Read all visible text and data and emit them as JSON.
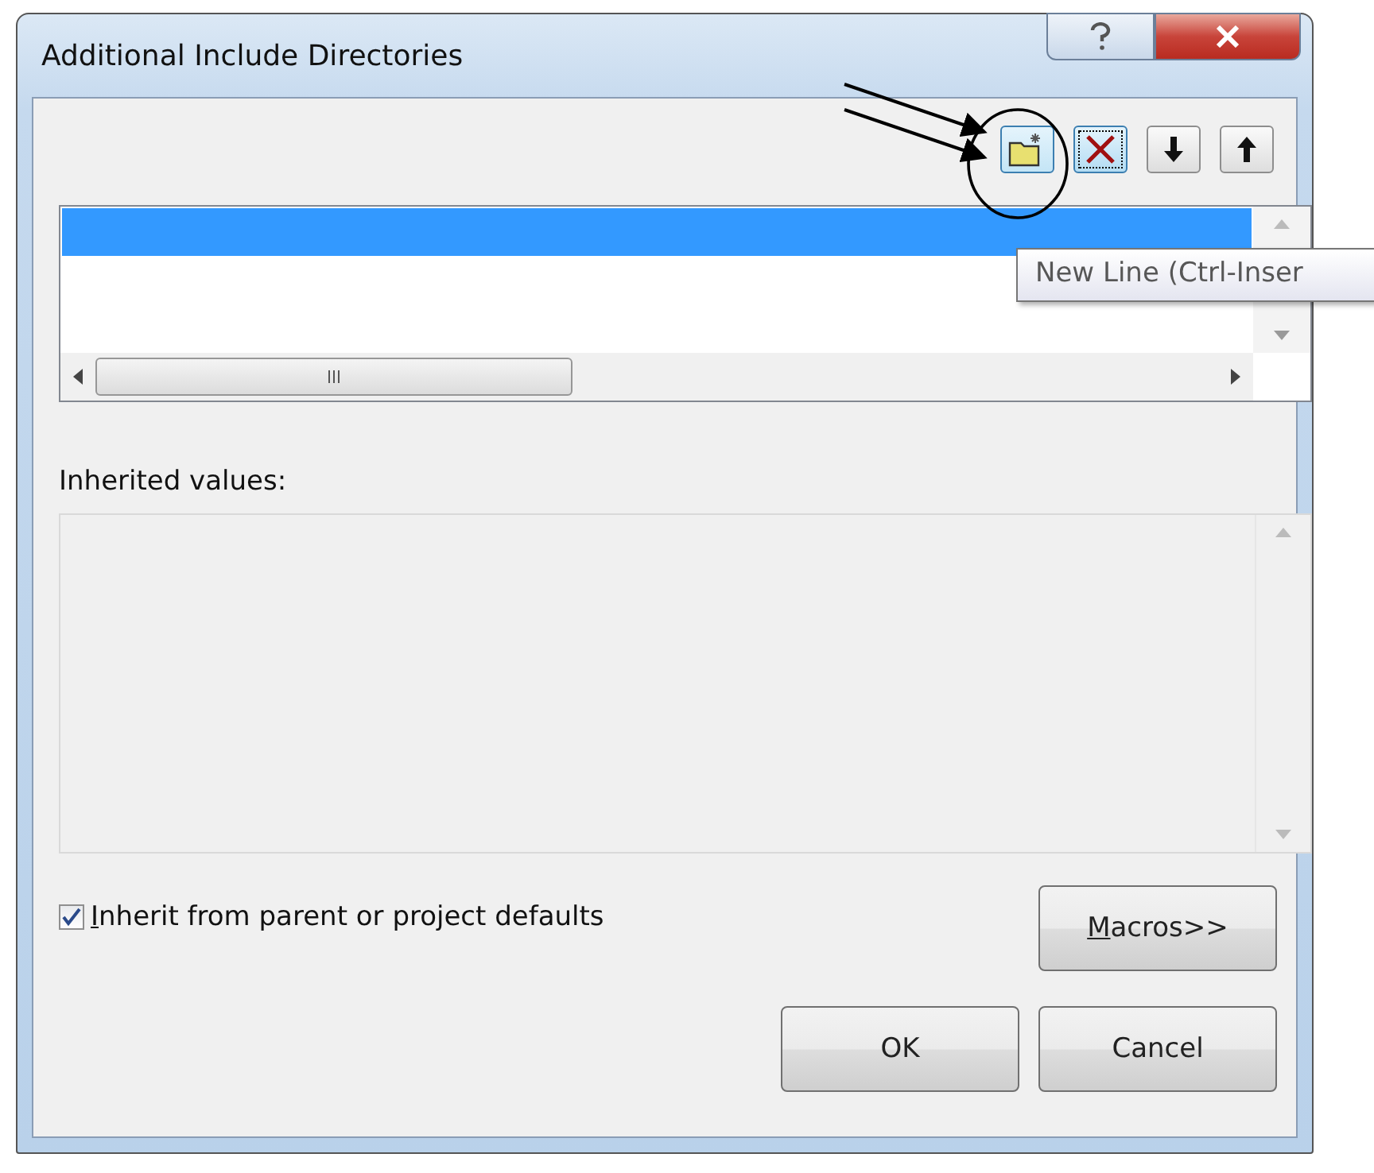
{
  "window": {
    "title": "Additional Include Directories"
  },
  "toolbar": [
    {
      "kind": "new-line",
      "focused": false
    },
    {
      "kind": "delete",
      "focused": true
    },
    {
      "kind": "move-down",
      "focused": false
    },
    {
      "kind": "move-up",
      "focused": false
    }
  ],
  "directory_list": {
    "rows": [
      {
        "selected": true
      }
    ]
  },
  "tooltip": "New Line (Ctrl-Inser",
  "inherited": {
    "label": "Inherited values:"
  },
  "checkbox": {
    "label": "Inherit from parent or project defaults",
    "underlined_first_letter": true,
    "checked": true
  },
  "buttons": [
    {
      "label": "Macros>>",
      "underlined_first_letter": true
    },
    {
      "label": "OK",
      "underlined_first_letter": false
    },
    {
      "label": "Cancel",
      "underlined_first_letter": false
    }
  ]
}
